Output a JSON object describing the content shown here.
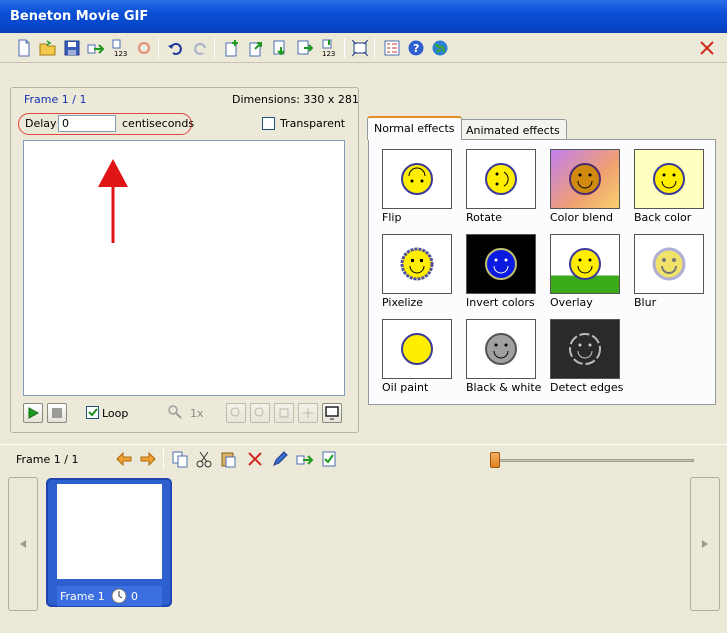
{
  "window": {
    "title": "Beneton Movie GIF"
  },
  "toolbar": {
    "icons": [
      "new-icon",
      "open-icon",
      "save-icon",
      "export-icon",
      "numbering-icon",
      "refresh-icon",
      "undo-icon",
      "redo-icon",
      "add-frame-icon",
      "insert-frame-icon",
      "import-icon",
      "export-frames-icon",
      "renumber-icon",
      "resize-icon",
      "list-icon",
      "help-icon",
      "web-icon",
      "close-icon"
    ]
  },
  "frame_panel": {
    "frame_label": "Frame 1 / 1",
    "dimensions": "Dimensions: 330 x 281",
    "delay_label": "Delay",
    "delay_value": "0",
    "delay_unit": "centiseconds",
    "transparent_label": "Transparent",
    "loop_label": "Loop",
    "zoom_label": "1x"
  },
  "effects": {
    "tabs": [
      "Normal effects",
      "Animated effects"
    ],
    "items": [
      {
        "label": "Flip"
      },
      {
        "label": "Rotate"
      },
      {
        "label": "Color blend"
      },
      {
        "label": "Back color"
      },
      {
        "label": "Pixelize"
      },
      {
        "label": "Invert colors"
      },
      {
        "label": "Overlay"
      },
      {
        "label": "Blur"
      },
      {
        "label": "Oil paint"
      },
      {
        "label": "Black & white"
      },
      {
        "label": "Detect edges"
      }
    ]
  },
  "timeline": {
    "frame_label": "Frame 1 / 1",
    "slider_value": 0
  },
  "filmstrip": {
    "frames": [
      {
        "name": "Frame 1",
        "delay": "0"
      }
    ]
  },
  "colors": {
    "accent": "#E68B2C",
    "titlebar": "#0A4FD5",
    "selection": "#2E5FCF"
  }
}
